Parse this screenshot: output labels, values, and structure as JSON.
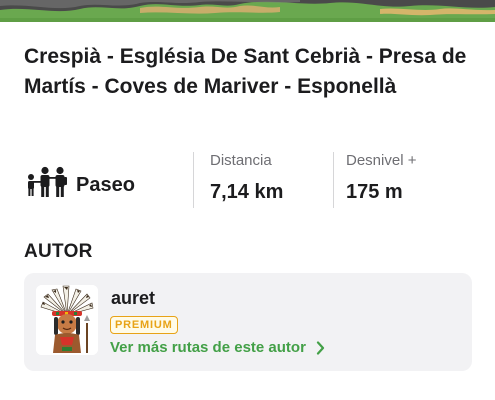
{
  "route": {
    "title": "Crespià - Església De Sant Cebrià - Presa de Martís - Coves de Mariver - Esponellà"
  },
  "stats": {
    "activity": {
      "icon": "family-icon",
      "label": "Paseo"
    },
    "distance": {
      "label": "Distancia",
      "value": "7,14 km"
    },
    "elevation": {
      "label": "Desnivel +",
      "value": "175 m"
    }
  },
  "author_section": {
    "heading": "AUTOR",
    "name": "auret",
    "badge": "PREMIUM",
    "more_routes_link": "Ver más rutas de este autor",
    "avatar_icon": "chief-headdress-avatar-icon",
    "link_icon": "chevron-right-icon"
  },
  "colors": {
    "accent_green": "#43a047",
    "premium_gold": "#e8a317",
    "card_background": "#f2f2f4",
    "hero_grass": "#6aa84f",
    "hero_terrain": "#c7ad6a"
  }
}
